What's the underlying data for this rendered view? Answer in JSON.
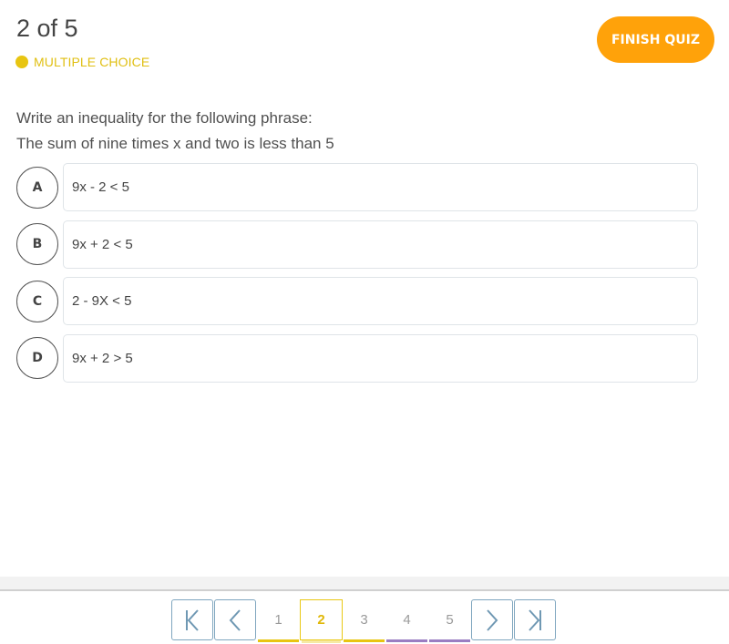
{
  "header": {
    "progress": "2 of 5",
    "question_type": "MULTIPLE CHOICE",
    "question_type_color": "#e8c511",
    "finish_button": "FINISH QUIZ",
    "finish_button_color": "#ffa20a"
  },
  "question": {
    "line1": "Write an inequality for the following phrase:",
    "line2": "The sum of nine times x and two is less than   5"
  },
  "choices": [
    {
      "letter": "A",
      "text": "9x - 2 < 5"
    },
    {
      "letter": "B",
      "text": "9x + 2  < 5"
    },
    {
      "letter": "C",
      "text": "2 - 9X < 5"
    },
    {
      "letter": "D",
      "text": "9x + 2 > 5"
    }
  ],
  "pagination": {
    "first_icon": "first-page-icon",
    "prev_icon": "chevron-left-icon",
    "next_icon": "chevron-right-icon",
    "last_icon": "last-page-icon",
    "current_page": 2,
    "pages": [
      {
        "label": "1",
        "status_color": "#e8c511"
      },
      {
        "label": "2",
        "status_color": "#e8c511"
      },
      {
        "label": "3",
        "status_color": "#e8c511"
      },
      {
        "label": "4",
        "status_color": "#9a7dc2"
      },
      {
        "label": "5",
        "status_color": "#9a7dc2"
      }
    ]
  }
}
